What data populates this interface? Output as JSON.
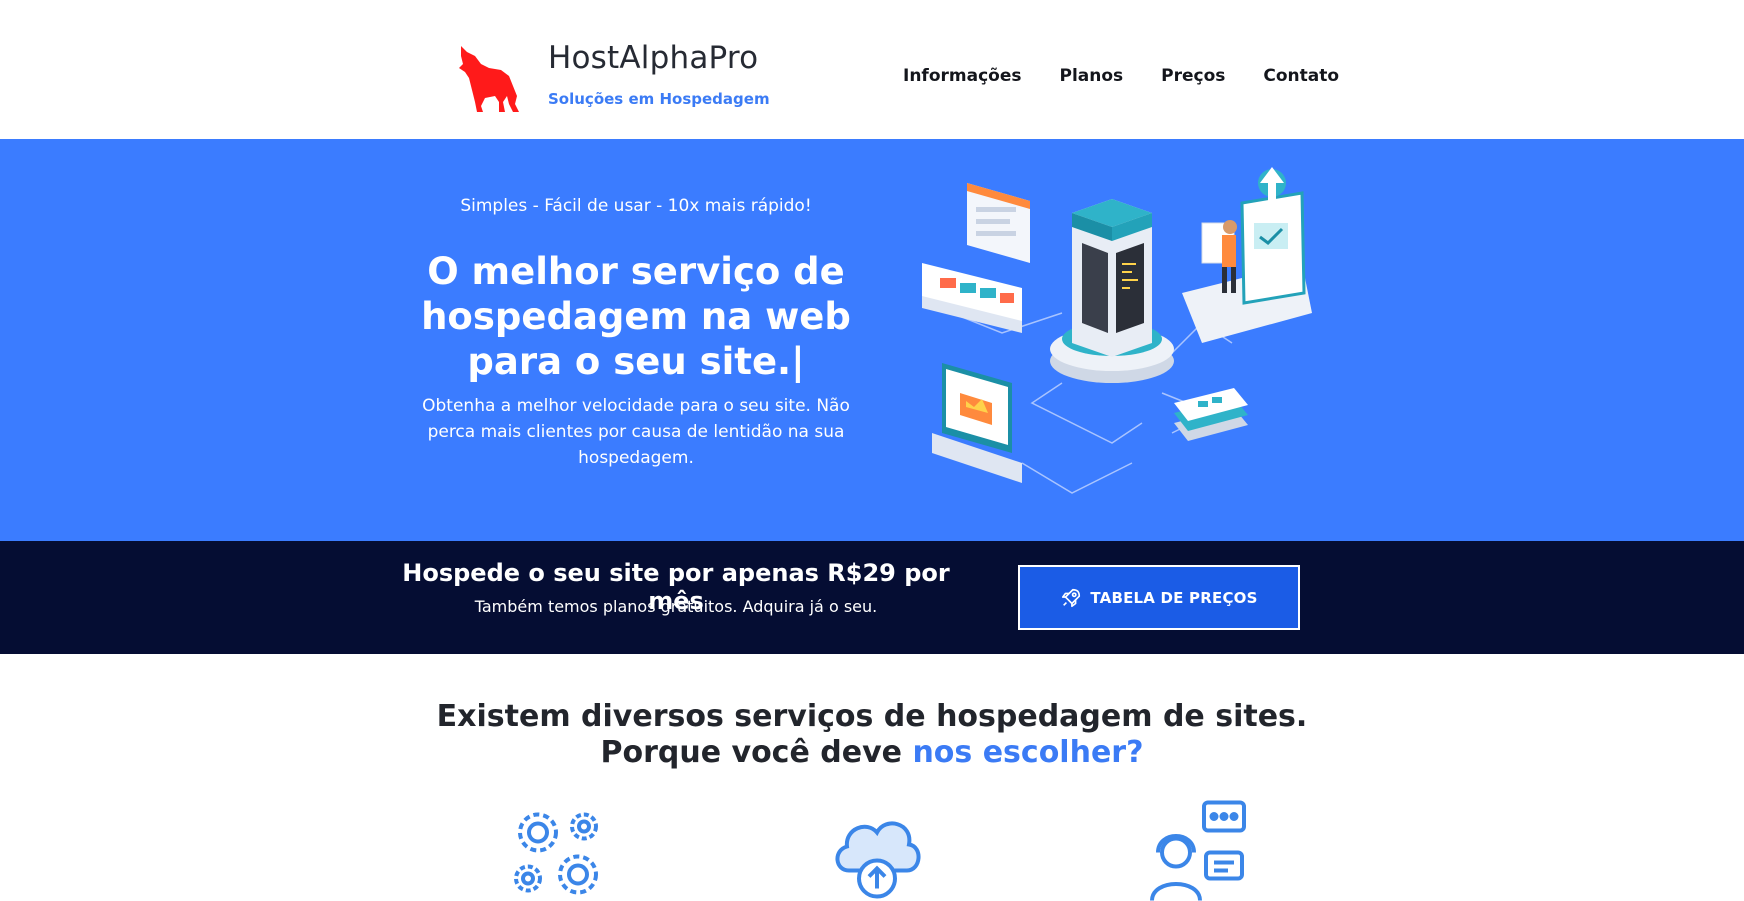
{
  "header": {
    "brand_name": "HostAlphaPro",
    "brand_tagline": "Soluções em Hospedagem",
    "logo_icon": "wolf-howling-icon",
    "logo_color": "#ff1a1a"
  },
  "nav": {
    "items": [
      {
        "label": "Informações"
      },
      {
        "label": "Planos"
      },
      {
        "label": "Preços"
      },
      {
        "label": "Contato"
      }
    ]
  },
  "hero": {
    "kicker": "Simples - Fácil de usar - 10x mais rápido!",
    "title_lines": [
      "O melhor serviço de",
      "hospedagem na web",
      "para o seu site.|"
    ],
    "description": "Obtenha a melhor velocidade para o seu site. Não perca mais clientes por causa de lentidão na sua hospedagem.",
    "background_color": "#3b7cff",
    "illustration": "isometric-hosting-server-illustration"
  },
  "cta": {
    "title": "Hospede o seu site por apenas R$29 por mês",
    "subtitle": "Também temos planos gratuitos. Adquira já o seu.",
    "button_label": "TABELA DE PREÇOS",
    "button_icon": "rocket-icon",
    "background_color": "#050d33",
    "button_color": "#1b5ce6"
  },
  "why": {
    "title_line1": "Existem diversos serviços de hospedagem de sites.",
    "title_line2_prefix": "Porque você deve ",
    "title_line2_accent": "nos escolher?",
    "accent_color": "#3b7bf5",
    "features": [
      {
        "icon": "gears-icon"
      },
      {
        "icon": "cloud-upload-icon"
      },
      {
        "icon": "customer-support-icon"
      }
    ]
  }
}
